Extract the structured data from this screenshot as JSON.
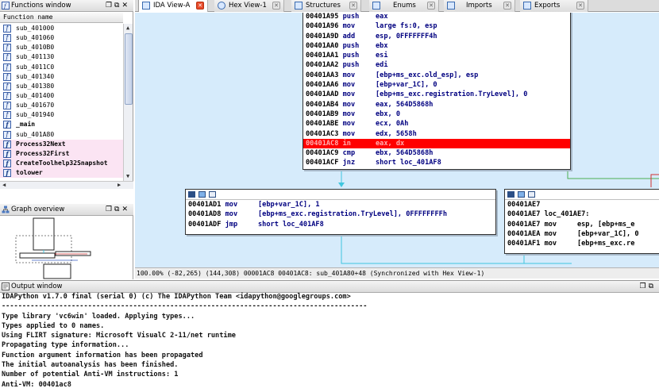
{
  "functions_window": {
    "title": "Functions window",
    "column_header": "Function name",
    "functions": [
      {
        "name": "sub_401000",
        "bold": false,
        "highlighted": false
      },
      {
        "name": "sub_401060",
        "bold": false,
        "highlighted": false
      },
      {
        "name": "sub_4010B0",
        "bold": false,
        "highlighted": false
      },
      {
        "name": "sub_401130",
        "bold": false,
        "highlighted": false
      },
      {
        "name": "sub_4011C0",
        "bold": false,
        "highlighted": false
      },
      {
        "name": "sub_401340",
        "bold": false,
        "highlighted": false
      },
      {
        "name": "sub_401380",
        "bold": false,
        "highlighted": false
      },
      {
        "name": "sub_401400",
        "bold": false,
        "highlighted": false
      },
      {
        "name": "sub_401670",
        "bold": false,
        "highlighted": false
      },
      {
        "name": "sub_401940",
        "bold": false,
        "highlighted": false
      },
      {
        "name": "_main",
        "bold": true,
        "highlighted": false
      },
      {
        "name": "sub_401A80",
        "bold": false,
        "highlighted": false
      },
      {
        "name": "Process32Next",
        "bold": true,
        "highlighted": true
      },
      {
        "name": "Process32First",
        "bold": true,
        "highlighted": true
      },
      {
        "name": "CreateToolhelp32Snapshot",
        "bold": true,
        "highlighted": true
      },
      {
        "name": "tolower",
        "bold": true,
        "highlighted": true
      }
    ]
  },
  "graph_overview": {
    "title": "Graph overview"
  },
  "tabs": [
    {
      "label": "IDA View-A",
      "active": true
    },
    {
      "label": "Hex View-1",
      "active": false
    },
    {
      "label": "Structures",
      "active": false
    },
    {
      "label": "Enums",
      "active": false
    },
    {
      "label": "Imports",
      "active": false
    },
    {
      "label": "Exports",
      "active": false
    }
  ],
  "graph": {
    "top_block": [
      {
        "addr": "00401A95",
        "op": "push",
        "arg": "eax"
      },
      {
        "addr": "00401A96",
        "op": "mov",
        "arg": "large fs:0, esp"
      },
      {
        "addr": "00401A9D",
        "op": "add",
        "arg": "esp, 0FFFFFFF4h"
      },
      {
        "addr": "00401AA0",
        "op": "push",
        "arg": "ebx"
      },
      {
        "addr": "00401AA1",
        "op": "push",
        "arg": "esi"
      },
      {
        "addr": "00401AA2",
        "op": "push",
        "arg": "edi"
      },
      {
        "addr": "00401AA3",
        "op": "mov",
        "arg": "[ebp+ms_exc.old_esp], esp"
      },
      {
        "addr": "00401AA6",
        "op": "mov",
        "arg": "[ebp+var_1C], 0"
      },
      {
        "addr": "00401AAD",
        "op": "mov",
        "arg": "[ebp+ms_exc.registration.TryLevel], 0"
      },
      {
        "addr": "00401AB4",
        "op": "mov",
        "arg": "eax, 564D5868h"
      },
      {
        "addr": "00401AB9",
        "op": "mov",
        "arg": "ebx, 0"
      },
      {
        "addr": "00401ABE",
        "op": "mov",
        "arg": "ecx, 0Ah"
      },
      {
        "addr": "00401AC3",
        "op": "mov",
        "arg": "edx, 5658h"
      },
      {
        "addr": "00401AC8",
        "op": "in",
        "arg": "eax, dx"
      },
      {
        "addr": "00401AC9",
        "op": "cmp",
        "arg": "ebx, 564D5868h"
      },
      {
        "addr": "00401ACF",
        "op": "jnz",
        "arg": "short loc_401AF8"
      }
    ],
    "highlighted_addr": "00401AC8",
    "left_block": [
      {
        "addr": "00401AD1",
        "op": "mov",
        "arg": "[ebp+var_1C], 1"
      },
      {
        "addr": "00401AD8",
        "op": "mov",
        "arg": "[ebp+ms_exc.registration.TryLevel], 0FFFFFFFFh"
      },
      {
        "addr": "00401ADF",
        "op": "jmp",
        "arg": "short loc_401AF8"
      }
    ],
    "right_block": [
      {
        "text": "00401AE7"
      },
      {
        "text": "00401AE7 loc_401AE7:"
      },
      {
        "text": "00401AE7 mov     esp, [ebp+ms_e"
      },
      {
        "text": "00401AEA mov     [ebp+var_1C], 0"
      },
      {
        "text": "00401AF1 mov     [ebp+ms_exc.re"
      }
    ]
  },
  "status_line": "100.00% (-82,265) (144,308) 00001AC8 00401AC8: sub_401A80+48 (Synchronized with Hex View-1)",
  "output_window": {
    "title": "Output window",
    "lines": [
      "IDAPython v1.7.0 final (serial 0) (c) The IDAPython Team <idapython@googlegroups.com>",
      "-----------------------------------------------------------------------------------------",
      "Type library 'vc6win' loaded. Applying types...",
      "Types applied to 0 names.",
      "Using FLIRT signature: Microsoft VisualC 2-11/net runtime",
      "Propagating type information...",
      "Function argument information has been propagated",
      "The initial autoanalysis has been finished.",
      "Number of potential Anti-VM instructions: 1",
      "Anti-VM: 00401ac8"
    ]
  },
  "icons": {
    "function": "function-icon",
    "graph": "graph-icon",
    "output": "output-icon"
  },
  "colors": {
    "graph_background": "#d6ebfb",
    "highlight": "#ff0000",
    "library_function_bg": "#fbe4f3",
    "edge_cyan": "#3fc6df",
    "edge_green": "#4caf50"
  }
}
